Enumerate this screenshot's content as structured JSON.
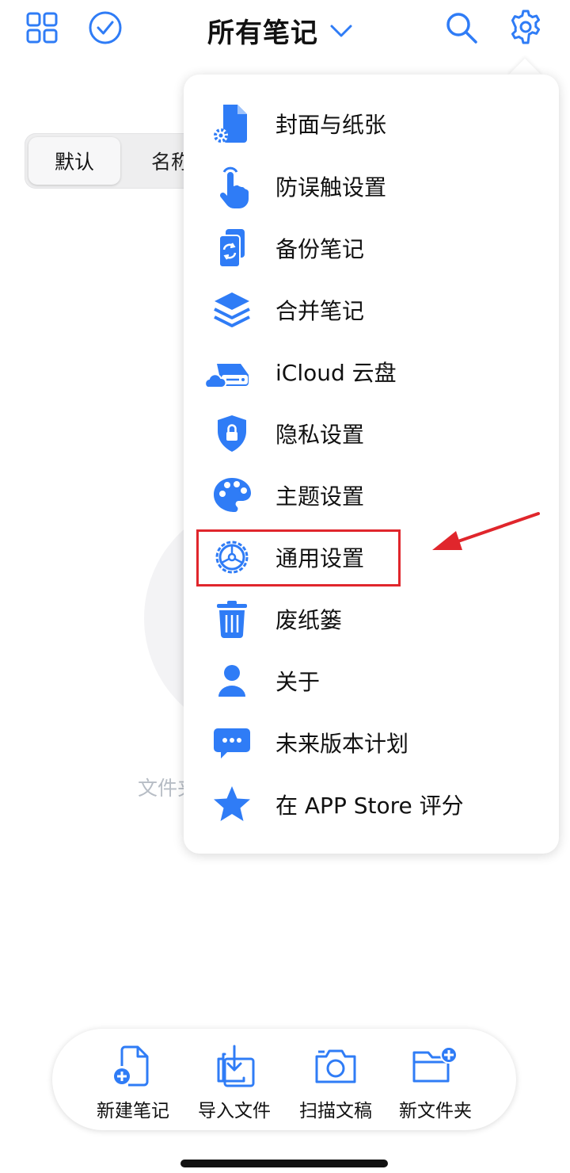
{
  "header": {
    "title": "所有笔记"
  },
  "sort_segment": {
    "default_label": "默认",
    "name_label": "名称"
  },
  "empty_state": {
    "text": "文件夹"
  },
  "menu": {
    "items": [
      {
        "label": "封面与纸张",
        "icon": "cover-paper-icon"
      },
      {
        "label": "防误触设置",
        "icon": "touch-hand-icon"
      },
      {
        "label": "备份笔记",
        "icon": "backup-icon"
      },
      {
        "label": "合并笔记",
        "icon": "layers-icon"
      },
      {
        "label": "iCloud 云盘",
        "icon": "icloud-drive-icon"
      },
      {
        "label": "隐私设置",
        "icon": "shield-lock-icon"
      },
      {
        "label": "主题设置",
        "icon": "palette-icon"
      },
      {
        "label": "通用设置",
        "icon": "general-settings-icon"
      },
      {
        "label": "废纸篓",
        "icon": "trash-icon"
      },
      {
        "label": "关于",
        "icon": "person-icon"
      },
      {
        "label": "未来版本计划",
        "icon": "chat-bubble-icon"
      },
      {
        "label": "在 APP Store 评分",
        "icon": "star-icon"
      }
    ],
    "highlighted_item": "通用设置"
  },
  "toolbar": {
    "new_note": "新建笔记",
    "import_file": "导入文件",
    "scan_document": "扫描文稿",
    "new_folder": "新文件夹"
  },
  "colors": {
    "accent": "#2f7cf6",
    "highlight": "#e0262c",
    "text": "#111111"
  }
}
